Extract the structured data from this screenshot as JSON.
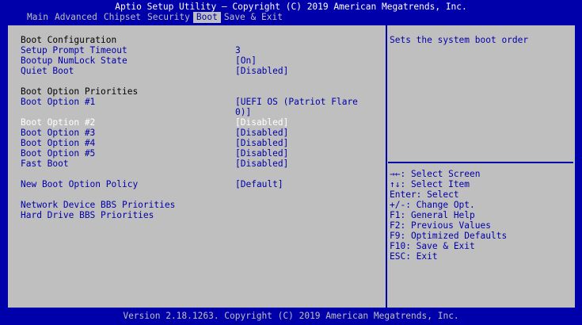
{
  "header": {
    "title": "Aptio Setup Utility – Copyright (C) 2019 American Megatrends, Inc."
  },
  "tabs": [
    {
      "label": "Main"
    },
    {
      "label": "Advanced"
    },
    {
      "label": "Chipset"
    },
    {
      "label": "Security"
    },
    {
      "label": "Boot",
      "active": true
    },
    {
      "label": "Save & Exit"
    }
  ],
  "boot": {
    "section_config": "Boot Configuration",
    "setup_prompt_timeout": {
      "label": "Setup Prompt Timeout",
      "value": "3"
    },
    "bootup_numlock": {
      "label": "Bootup NumLock State",
      "value": "[On]"
    },
    "quiet_boot": {
      "label": "Quiet Boot",
      "value": "[Disabled]"
    },
    "section_priorities": "Boot Option Priorities",
    "boot_option_1": {
      "label": "Boot Option #1",
      "value_line1": "[UEFI OS (Patriot Flare",
      "value_line2": "0)]"
    },
    "boot_option_2": {
      "label": "Boot Option #2",
      "value": "[Disabled]"
    },
    "boot_option_3": {
      "label": "Boot Option #3",
      "value": "[Disabled]"
    },
    "boot_option_4": {
      "label": "Boot Option #4",
      "value": "[Disabled]"
    },
    "boot_option_5": {
      "label": "Boot Option #5",
      "value": "[Disabled]"
    },
    "fast_boot": {
      "label": "Fast Boot",
      "value": "[Disabled]"
    },
    "new_boot_option_policy": {
      "label": "New Boot Option Policy",
      "value": "[Default]"
    },
    "network_bbs": {
      "label": "Network Device BBS Priorities"
    },
    "hdd_bbs": {
      "label": "Hard Drive BBS Priorities"
    }
  },
  "help": {
    "description": "Sets the system boot order",
    "keys": [
      "→←: Select Screen",
      "↑↓: Select Item",
      "Enter: Select",
      "+/-: Change Opt.",
      "F1: General Help",
      "F2: Previous Values",
      "F9: Optimized Defaults",
      "F10: Save & Exit",
      "ESC: Exit"
    ]
  },
  "footer": {
    "version": "Version 2.18.1263. Copyright (C) 2019 American Megatrends, Inc."
  },
  "colors": {
    "background": "#0000aa",
    "panel": "#bfbfbf",
    "selected_text": "#ffffff",
    "label_text": "#000000"
  }
}
